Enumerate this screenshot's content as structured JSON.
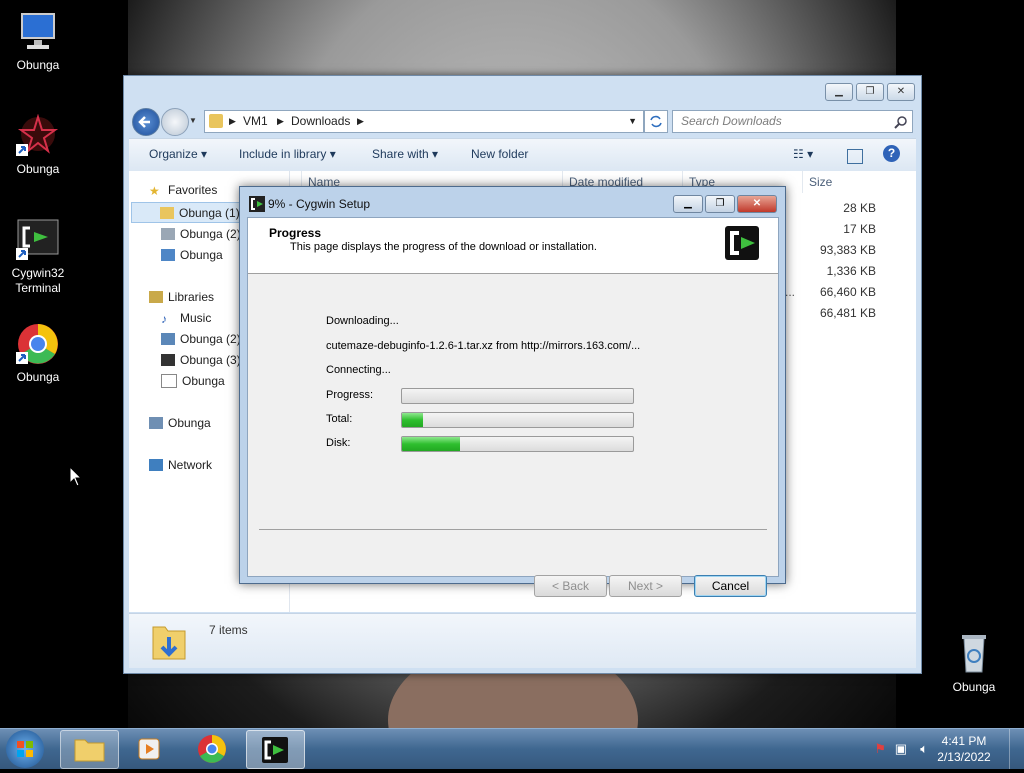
{
  "desktop": {
    "icons": [
      {
        "label": "Obunga"
      },
      {
        "label": "Obunga"
      },
      {
        "label": "Cygwin32 Terminal"
      },
      {
        "label": "Obunga"
      },
      {
        "label": "Obunga"
      }
    ]
  },
  "explorer": {
    "breadcrumb": [
      "VM1",
      "Downloads"
    ],
    "search_placeholder": "Search Downloads",
    "toolbar": {
      "organize": "Organize",
      "include": "Include in library",
      "share": "Share with",
      "new_folder": "New folder"
    },
    "nav": {
      "favorites": "Favorites",
      "fav_items": [
        "Obunga (1)",
        "Obunga (2)",
        "Obunga"
      ],
      "libraries": "Libraries",
      "lib_items": [
        "Music",
        "Obunga (2)",
        "Obunga (3)",
        "Obunga"
      ],
      "homegroup": "Obunga",
      "network": "Network"
    },
    "columns": {
      "name": "Name",
      "date": "Date modified",
      "type": "Type",
      "size": "Size"
    },
    "sizes": [
      "28 KB",
      "17 KB",
      "93,383 KB",
      "1,336 KB",
      "66,460 KB",
      "66,481 KB"
    ],
    "type_ellipsis": "...",
    "status": "7 items"
  },
  "dialog": {
    "title": "9% - Cygwin Setup",
    "heading": "Progress",
    "subheading": "This page displays the progress of the download or installation.",
    "line1": "Downloading...",
    "line2": "cutemaze-debuginfo-1.2.6-1.tar.xz from http://mirrors.163.com/...",
    "line3": "Connecting...",
    "labels": {
      "progress": "Progress:",
      "total": "Total:",
      "disk": "Disk:"
    },
    "progress_pct": {
      "progress": 0,
      "total": 9,
      "disk": 25
    },
    "buttons": {
      "back": "< Back",
      "next": "Next >",
      "cancel": "Cancel"
    }
  },
  "taskbar": {
    "time": "4:41 PM",
    "date": "2/13/2022"
  }
}
